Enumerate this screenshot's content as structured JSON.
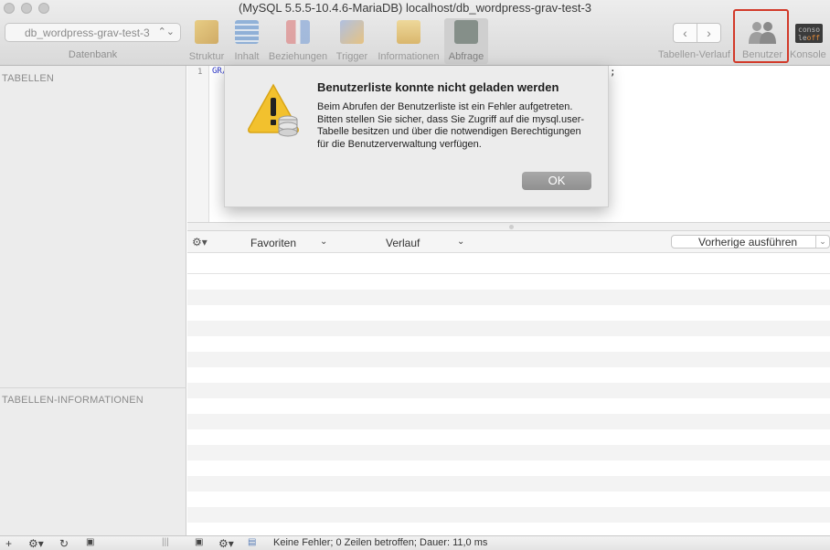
{
  "window": {
    "title": "(MySQL 5.5.5-10.4.6-MariaDB) localhost/db_wordpress-grav-test-3"
  },
  "toolbar": {
    "database_select": {
      "value": "db_wordpress-grav-test-3",
      "label": "Datenbank"
    },
    "views": [
      {
        "label": "Struktur",
        "icon": "structure-icon",
        "color": "#d9a53a"
      },
      {
        "label": "Inhalt",
        "icon": "table-content-icon",
        "color": "#5f90c8"
      },
      {
        "label": "Beziehungen",
        "icon": "relations-icon",
        "color": "#c86a6a"
      },
      {
        "label": "Trigger",
        "icon": "trigger-icon",
        "color": "#7a8ec8"
      },
      {
        "label": "Informationen",
        "icon": "info-icon",
        "color": "#d9a53a"
      },
      {
        "label": "Abfrage",
        "icon": "query-terminal-icon",
        "color": "#5a6a5a",
        "active": true
      }
    ],
    "history_label": "Tabellen-Verlauf",
    "users_label": "Benutzer",
    "console": {
      "label": "Konsole",
      "icon_text_1": "conso",
      "icon_text_2": "le",
      "icon_text_3": "off"
    }
  },
  "sidebar": {
    "tables_header": "TABELLEN",
    "info_header": "TABELLEN-INFORMATIONEN"
  },
  "editor": {
    "line_number": "1",
    "code_start": "GR/",
    "code_end": ";"
  },
  "query_bar": {
    "favorites_label": "Favoriten",
    "history_label": "Verlauf",
    "run_previous_label": "Vorherige ausführen"
  },
  "dialog": {
    "title": "Benutzerliste konnte nicht geladen werden",
    "message": "Beim Abrufen der Benutzerliste ist ein Fehler aufgetreten. Bitten stellen Sie sicher, dass Sie Zugriff auf die mysql.user-Tabelle besitzen und über die notwendigen Berechtigungen für die Benutzerverwaltung verfügen.",
    "ok_label": "OK",
    "icon": "warning-database-icon"
  },
  "status_bar": {
    "message": "Keine Fehler; 0 Zeilen betroffen; Dauer: 11,0 ms"
  },
  "colors": {
    "highlight_border": "#d23a2a",
    "warning_yellow": "#f2c12e"
  }
}
